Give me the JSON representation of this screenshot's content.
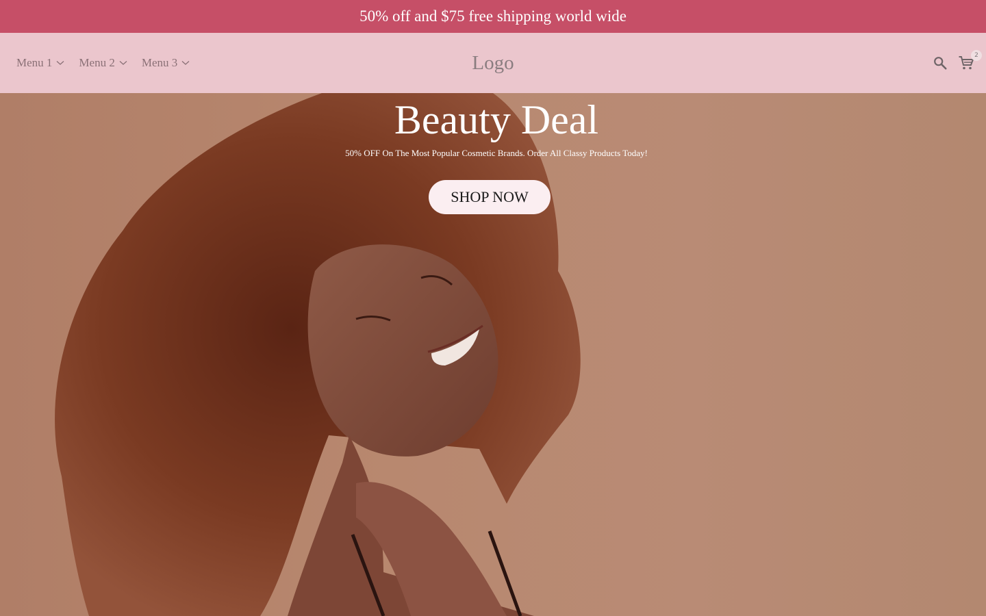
{
  "announcement": {
    "text": "50% off and $75 free shipping world wide"
  },
  "header": {
    "menu": [
      {
        "label": "Menu 1",
        "icon": "chevron-down-icon"
      },
      {
        "label": "Menu 2",
        "icon": "chevron-down-icon"
      },
      {
        "label": "Menu 3",
        "icon": "chevron-down-icon"
      }
    ],
    "logo": "Logo",
    "search_icon": "search-icon",
    "cart_icon": "cart-icon",
    "cart_count": "2"
  },
  "hero": {
    "title": "Beauty Deal",
    "subtitle": "50% OFF On The Most Popular Cosmetic Brands. Order All Classy Products Today!",
    "cta_label": "SHOP NOW"
  },
  "colors": {
    "announcement_bg": "#c64f67",
    "header_bg": "#ebc6cd",
    "hero_bg": "#b8886f",
    "cta_bg": "#fbeef1"
  }
}
